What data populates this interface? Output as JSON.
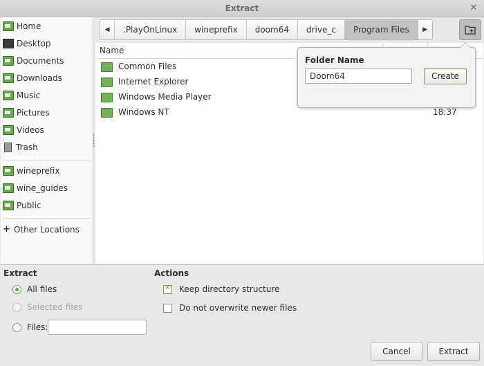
{
  "window": {
    "title": "Extract",
    "close_glyph": "✕"
  },
  "sidebar": {
    "places": [
      {
        "label": "Home",
        "icon": "home-folder-icon"
      },
      {
        "label": "Desktop",
        "icon": "desktop-icon"
      },
      {
        "label": "Documents",
        "icon": "documents-folder-icon"
      },
      {
        "label": "Downloads",
        "icon": "downloads-folder-icon"
      },
      {
        "label": "Music",
        "icon": "music-folder-icon"
      },
      {
        "label": "Pictures",
        "icon": "pictures-folder-icon"
      },
      {
        "label": "Videos",
        "icon": "videos-folder-icon"
      },
      {
        "label": "Trash",
        "icon": "trash-icon"
      }
    ],
    "bookmarks": [
      {
        "label": "wineprefix",
        "icon": "folder-icon"
      },
      {
        "label": "wine_guides",
        "icon": "folder-icon"
      },
      {
        "label": "Public",
        "icon": "folder-icon"
      }
    ],
    "other": {
      "label": "Other Locations",
      "icon": "plus-icon"
    }
  },
  "pathbar": {
    "crumbs": [
      ".PlayOnLinux",
      "wineprefix",
      "doom64",
      "drive_c",
      "Program Files"
    ],
    "active": "Program Files",
    "left_arrow": "◀",
    "right_arrow": "▶"
  },
  "filelist": {
    "header": {
      "name": "Name"
    },
    "rows": [
      {
        "name": "Common Files",
        "time": ""
      },
      {
        "name": "Internet Explorer",
        "time": ""
      },
      {
        "name": "Windows Media Player",
        "time": ""
      },
      {
        "name": "Windows NT",
        "time": "18:37"
      }
    ]
  },
  "new_folder_popover": {
    "label": "Folder Name",
    "value": "Doom64",
    "create_label": "Create"
  },
  "extract_options": {
    "title": "Extract",
    "all_files": "All files",
    "selected_files": "Selected files",
    "files": "Files:",
    "files_value": ""
  },
  "actions": {
    "title": "Actions",
    "keep_structure": "Keep directory structure",
    "no_overwrite": "Do not overwrite newer files"
  },
  "buttons": {
    "cancel": "Cancel",
    "extract": "Extract"
  },
  "colors": {
    "accent": "#6f9e52",
    "folder": "#77b05a"
  }
}
